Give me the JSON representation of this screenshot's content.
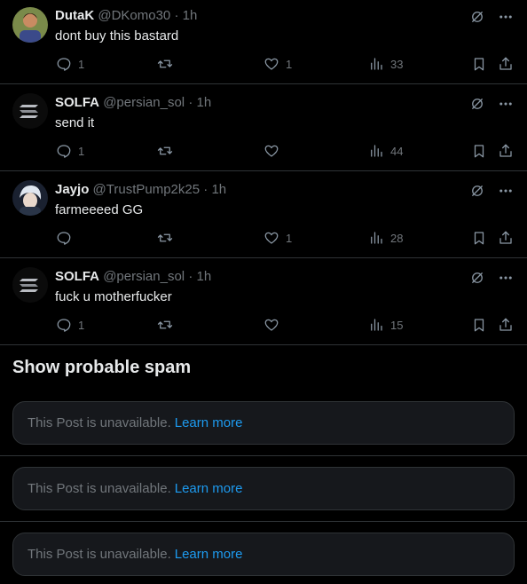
{
  "posts": [
    {
      "name": "DutaK",
      "handle": "@DKomo30",
      "time": "1h",
      "text": "dont buy this bastard",
      "replies": "1",
      "reposts": "",
      "likes": "1",
      "views": "33"
    },
    {
      "name": "SOLFA",
      "handle": "@persian_sol",
      "time": "1h",
      "text": "send it",
      "replies": "1",
      "reposts": "",
      "likes": "",
      "views": "44"
    },
    {
      "name": "Jayjo",
      "handle": "@TrustPump2k25",
      "time": "1h",
      "text": "farmeeeed GG",
      "replies": "",
      "reposts": "",
      "likes": "1",
      "views": "28"
    },
    {
      "name": "SOLFA",
      "handle": "@persian_sol",
      "time": "1h",
      "text": "fuck u motherfucker",
      "replies": "1",
      "reposts": "",
      "likes": "",
      "views": "15"
    }
  ],
  "separator": "·",
  "spam_header": "Show probable spam",
  "unavailable": [
    {
      "text": "This Post is unavailable.",
      "link": "Learn more"
    },
    {
      "text": "This Post is unavailable.",
      "link": "Learn more"
    },
    {
      "text": "This Post is unavailable.",
      "link": "Learn more"
    }
  ],
  "colors": {
    "background": "#000000",
    "text": "#e7e9ea",
    "muted": "#71767b",
    "link": "#1d9bf0",
    "border": "#2f3336"
  },
  "icons": [
    "grok-icon",
    "more-icon",
    "reply-icon",
    "repost-icon",
    "like-icon",
    "views-icon",
    "bookmark-icon",
    "share-icon"
  ]
}
